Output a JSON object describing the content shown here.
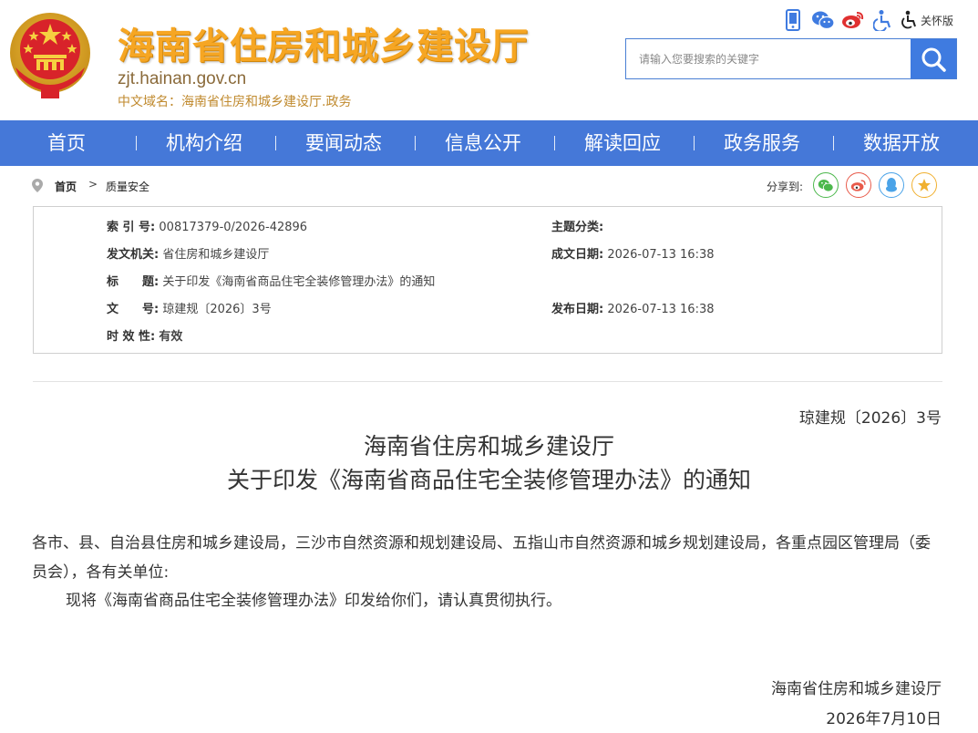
{
  "header": {
    "site_title": "海南省住房和城乡建设厅",
    "site_domain": "zjt.hainan.gov.cn",
    "cn_domain": "中文域名：海南省住房和城乡建设厅.政务",
    "care_mode": "关怀版",
    "top_icons": [
      "mobile-icon",
      "wechat-icon",
      "weibo-icon",
      "accessibility-icon"
    ],
    "search_placeholder": "请输入您要搜索的关键字"
  },
  "nav": {
    "items": [
      "首页",
      "机构介绍",
      "要闻动态",
      "信息公开",
      "解读回应",
      "政务服务",
      "数据开放"
    ]
  },
  "breadcrumb": {
    "home": "首页",
    "separator": ">",
    "current": "质量安全",
    "share_label": "分享到:"
  },
  "info": {
    "index_label": "索 引 号:",
    "index_value": "00817379-0/2026-42896",
    "topic_label": "主题分类:",
    "topic_value": "",
    "issuer_label": "发文机关:",
    "issuer_value": "省住房和城乡建设厅",
    "written_date_label": "成文日期:",
    "written_date_value": "2026-07-13 16:38",
    "title_label": "标　　题:",
    "title_value": "关于印发《海南省商品住宅全装修管理办法》的通知",
    "docno_label": "文　　号:",
    "docno_value": "琼建规〔2026〕3号",
    "publish_date_label": "发布日期:",
    "publish_date_value": "2026-07-13 16:38",
    "validity_label": "时 效 性:",
    "validity_value": "有效"
  },
  "article": {
    "doc_no": "琼建规〔2026〕3号",
    "title_line1": "海南省住房和城乡建设厅",
    "title_line2": "关于印发《海南省商品住宅全装修管理办法》的通知",
    "para1": "各市、县、自治县住房和城乡建设局，三沙市自然资源和规划建设局、五指山市自然资源和城乡规划建设局，各重点园区管理局（委员会），各有关单位:",
    "para2": "现将《海南省商品住宅全装修管理办法》印发给你们，请认真贯彻执行。",
    "signature": "海南省住房和城乡建设厅",
    "date": "2026年7月10日"
  },
  "colors": {
    "nav_bg": "#4578d8",
    "title_gold": "#f6a623",
    "search_btn": "#3f7be0"
  }
}
